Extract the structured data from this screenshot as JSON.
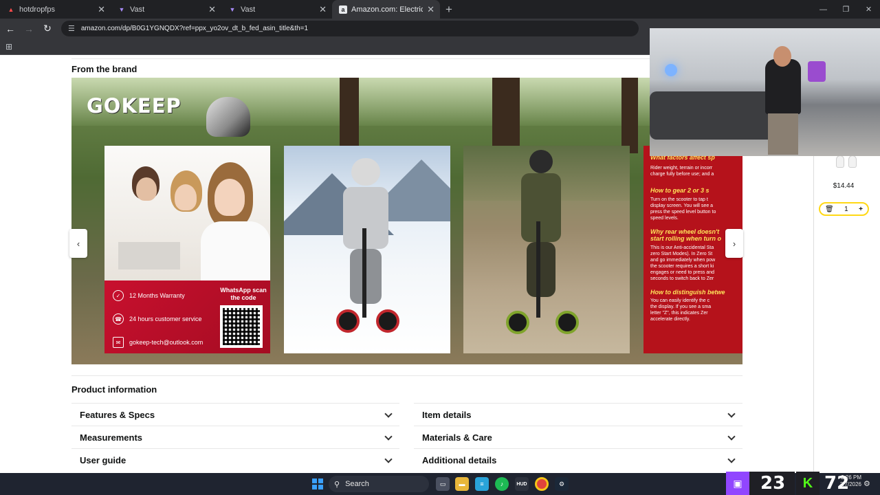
{
  "browser": {
    "tabs": [
      {
        "title": "hotdropfps",
        "favicon": "twitch-icon",
        "active": false
      },
      {
        "title": "Vast",
        "favicon": "vast-icon",
        "active": false
      },
      {
        "title": "Vast",
        "favicon": "vast-icon",
        "active": false
      },
      {
        "title": "Amazon.com: Electric Scooter,",
        "favicon": "amazon-icon",
        "active": true
      }
    ],
    "url": "amazon.com/dp/B0G1YGNQDX?ref=ppx_yo2ov_dt_b_fed_asin_title&th=1"
  },
  "brand_section": {
    "heading": "From the brand",
    "logo": "GOKEEP",
    "support_card": {
      "warranty": "12 Months Warranty",
      "service": "24 hours customer service",
      "email": "gokeep-tech@outlook.com",
      "whatsapp": "WhatsApp scan the code"
    },
    "tips_card": [
      {
        "heading": "What factors affect sp",
        "text": [
          "Rider weight, terrain or incorr",
          "charge fully before use; and a"
        ]
      },
      {
        "heading": "How to gear 2 or 3 s",
        "text": [
          "Turn on the scooter to tap t",
          "display screen. You will see a",
          "press the speed level button to",
          "speed levels."
        ]
      },
      {
        "heading": "Why rear wheel doesn't",
        "text": [
          "start rolling when turn o"
        ]
      },
      {
        "heading": "",
        "text": [
          "This is our Anti-accidental Sta",
          "zero Start Modes). In Zero St",
          "and go immediately when pow",
          "the scooter requires a short ki",
          "engages or need to press and",
          "seconds to switch back to Zer"
        ]
      },
      {
        "heading": "How to distinguish betwe",
        "text": [
          "You can easily identify the c",
          "the display. If you see a sma",
          "letter \"Z\", this indicates Zer",
          "accelerate directly."
        ]
      }
    ]
  },
  "product_information": {
    "heading": "Product information",
    "left": [
      "Features & Specs",
      "Measurements",
      "User guide"
    ],
    "right": [
      "Item details",
      "Materials & Care",
      "Additional details"
    ]
  },
  "cart_sidebar": {
    "price": "$14.44",
    "quantity": "1"
  },
  "taskbar": {
    "search": "Search",
    "stat_a": "23",
    "stat_b": "72",
    "time": "2:26 PM",
    "date": "2/7/2026"
  },
  "colors": {
    "amazon_yellow": "#ffd814",
    "brand_red": "#c8102e",
    "chrome_dark": "#202124"
  }
}
